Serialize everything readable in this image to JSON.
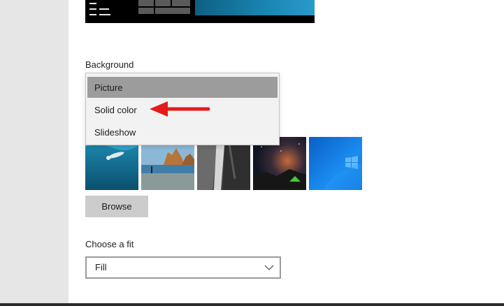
{
  "background_section": {
    "label": "Background",
    "dropdown_options": [
      {
        "label": "Picture",
        "selected": true
      },
      {
        "label": "Solid color",
        "selected": false
      },
      {
        "label": "Slideshow",
        "selected": false
      }
    ]
  },
  "thumbnails": [
    {
      "name": "underwater-swimmer"
    },
    {
      "name": "beach-rocks"
    },
    {
      "name": "waterfall-rock"
    },
    {
      "name": "night-sky-tent"
    },
    {
      "name": "windows-blue"
    }
  ],
  "browse_button": {
    "label": "Browse"
  },
  "fit_section": {
    "label": "Choose a fit",
    "value": "Fill"
  },
  "colors": {
    "selected_option_bg": "#9c9c9c",
    "annotation_arrow": "#e31b1b",
    "sidebar_bg": "#e6e6e6"
  }
}
